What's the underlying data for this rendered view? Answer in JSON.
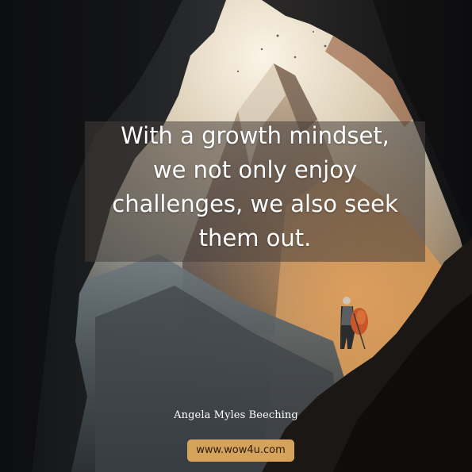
{
  "quote": {
    "lines": [
      "With a growth mindset,",
      "we not only enjoy",
      "challenges, we also seek",
      "them out."
    ]
  },
  "author": "Angela Myles Beeching",
  "website": "www.wow4u.com",
  "colors": {
    "badge": "#d6a35c",
    "text": "#ffffff",
    "sky_glow": "#f2e6cf"
  }
}
